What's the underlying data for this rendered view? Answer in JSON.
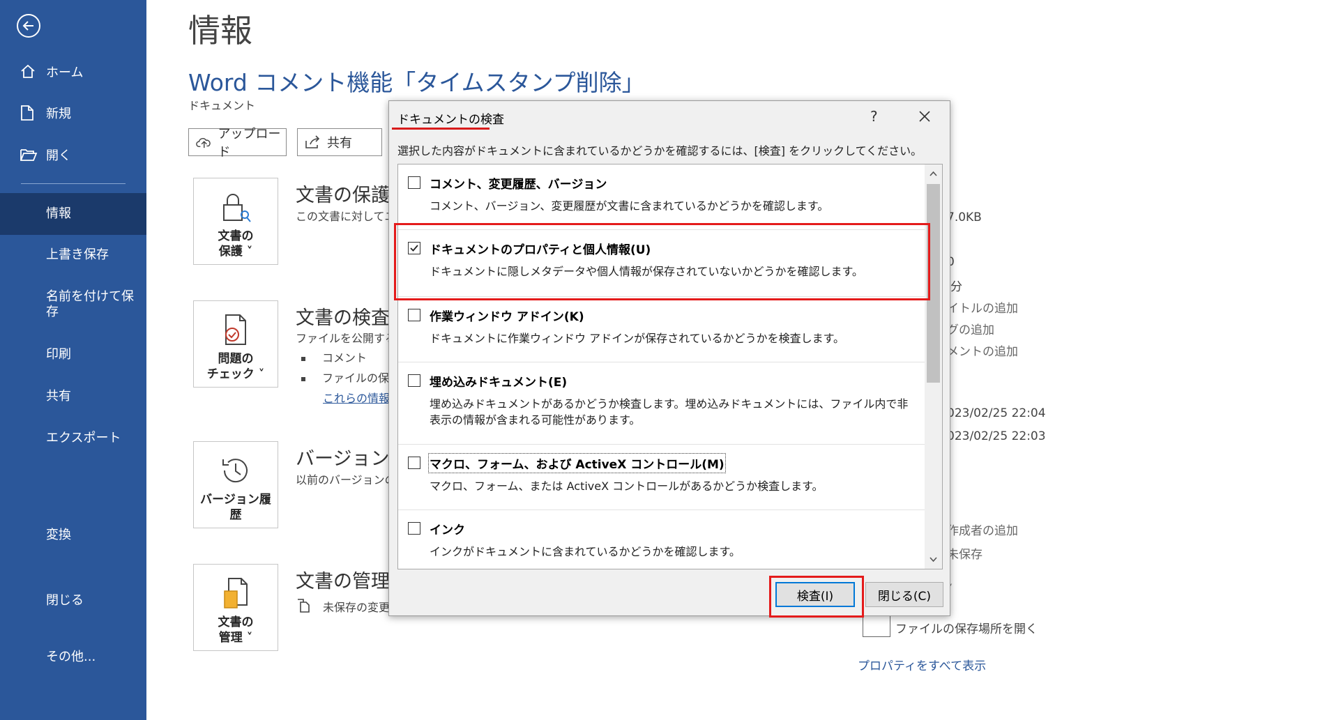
{
  "sidebar": {
    "items": [
      {
        "label": "ホーム",
        "icon": "home-icon"
      },
      {
        "label": "新規",
        "icon": "new-document-icon"
      },
      {
        "label": "開く",
        "icon": "folder-open-icon"
      },
      {
        "label": "情報"
      },
      {
        "label": "上書き保存"
      },
      {
        "label": "名前を付けて保存"
      },
      {
        "label": "印刷"
      },
      {
        "label": "共有"
      },
      {
        "label": "エクスポート"
      },
      {
        "label": "変換"
      },
      {
        "label": "閉じる"
      },
      {
        "label": "その他..."
      }
    ],
    "active": "情報"
  },
  "main": {
    "page_title": "情報",
    "doc_title": "Word コメント機能「タイムスタンプ削除」",
    "doc_subtitle": "ドキュメント",
    "buttons": {
      "upload": "アップロード",
      "share": "共有"
    },
    "sections": [
      {
        "card": [
          "文書の",
          "保護 ˅"
        ],
        "title": "文書の保護",
        "desc": "この文書に対してユ"
      },
      {
        "card": [
          "問題の",
          "チェック ˅"
        ],
        "title": "文書の検査",
        "desc": "ファイルを公開する前",
        "bullets": [
          "コメント",
          "ファイルの保存"
        ],
        "link": "これらの情報を"
      },
      {
        "card": [
          "バージョン履",
          "歴"
        ],
        "title": "バージョン履",
        "desc": "以前のバージョンの"
      },
      {
        "card": [
          "文書の",
          "管理 ˅"
        ],
        "title": "文書の管理",
        "desc": "未保存の変更"
      }
    ]
  },
  "properties": {
    "size": "7.0KB",
    "pages_partial": "0",
    "time_partial": "分",
    "add_title": "イトルの追加",
    "add_tag": "グの追加",
    "add_comment": "メントの追加",
    "date1": "023/02/25 22:04",
    "date2": "023/02/25 22:03",
    "add_author": "作成者の追加",
    "not_saved": "未保存",
    "chevron": "˅",
    "open_location": "ファイルの保存場所を開く",
    "show_all": "プロパティをすべて表示"
  },
  "dialog": {
    "title": "ドキュメントの検査",
    "help": "?",
    "description": "選択した内容がドキュメントに含まれているかどうかを確認するには、[検査] をクリックしてください。",
    "options": [
      {
        "title": "コメント、変更履歴、バージョン",
        "desc": "コメント、バージョン、変更履歴が文書に含まれているかどうかを確認します。",
        "checked": false
      },
      {
        "title": "ドキュメントのプロパティと個人情報(U)",
        "desc": "ドキュメントに隠しメタデータや個人情報が保存されていないかどうかを確認します。",
        "checked": true
      },
      {
        "title": "作業ウィンドウ アドイン(K)",
        "desc": "ドキュメントに作業ウィンドウ アドインが保存されているかどうかを検査します。",
        "checked": false
      },
      {
        "title": "埋め込みドキュメント(E)",
        "desc": "埋め込みドキュメントがあるかどうか検査します。埋め込みドキュメントには、ファイル内で非表示の情報が含まれる可能性があります。",
        "checked": false
      },
      {
        "title": "マクロ、フォーム、および ActiveX コントロール(M)",
        "desc": "マクロ、フォーム、または ActiveX コントロールがあるかどうか検査します。",
        "checked": false
      },
      {
        "title": "インク",
        "desc": "インクがドキュメントに含まれているかどうかを確認します。",
        "checked": false
      }
    ],
    "inspect_button": "検査(I)",
    "close_button": "閉じる(C)"
  },
  "colors": {
    "sidebar": "#2b579a",
    "sidebar_active": "#1b3a6b",
    "highlight": "#e41b1b",
    "link": "#2b579a"
  }
}
